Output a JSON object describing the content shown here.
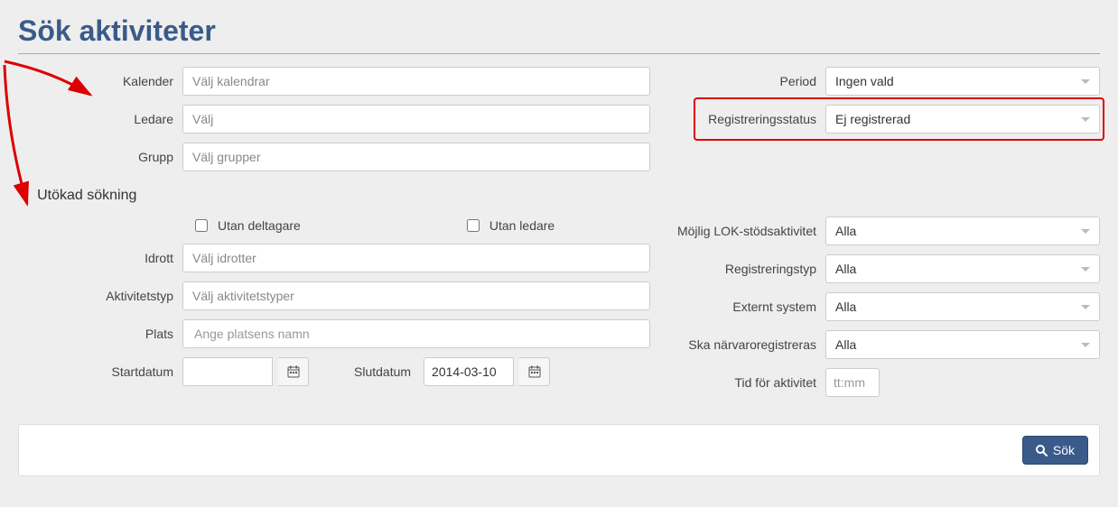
{
  "page_title": "Sök aktiviteter",
  "advanced_label": "Utökad sökning",
  "search_button_label": "Sök",
  "basic": {
    "kalender_label": "Kalender",
    "kalender_placeholder": "Välj kalendrar",
    "ledare_label": "Ledare",
    "ledare_placeholder": "Välj",
    "grupp_label": "Grupp",
    "grupp_placeholder": "Välj grupper",
    "period_label": "Period",
    "period_value": "Ingen vald",
    "regstatus_label": "Registreringsstatus",
    "regstatus_value": "Ej registrerad"
  },
  "advanced": {
    "without_participants_label": "Utan deltagare",
    "without_leaders_label": "Utan ledare",
    "idrott_label": "Idrott",
    "idrott_placeholder": "Välj idrotter",
    "aktivitetstyp_label": "Aktivitetstyp",
    "aktivitetstyp_placeholder": "Välj aktivitetstyper",
    "plats_label": "Plats",
    "plats_placeholder": "Ange platsens namn",
    "startdatum_label": "Startdatum",
    "startdatum_value": "",
    "slutdatum_label": "Slutdatum",
    "slutdatum_value": "2014-03-10",
    "lok_label": "Möjlig LOK-stödsaktivitet",
    "lok_value": "Alla",
    "registreringstyp_label": "Registreringstyp",
    "registreringstyp_value": "Alla",
    "external_label": "Externt system",
    "external_value": "Alla",
    "narvaro_label": "Ska närvaroregistreras",
    "narvaro_value": "Alla",
    "tid_label": "Tid för aktivitet",
    "tid_placeholder": "tt:mm"
  }
}
